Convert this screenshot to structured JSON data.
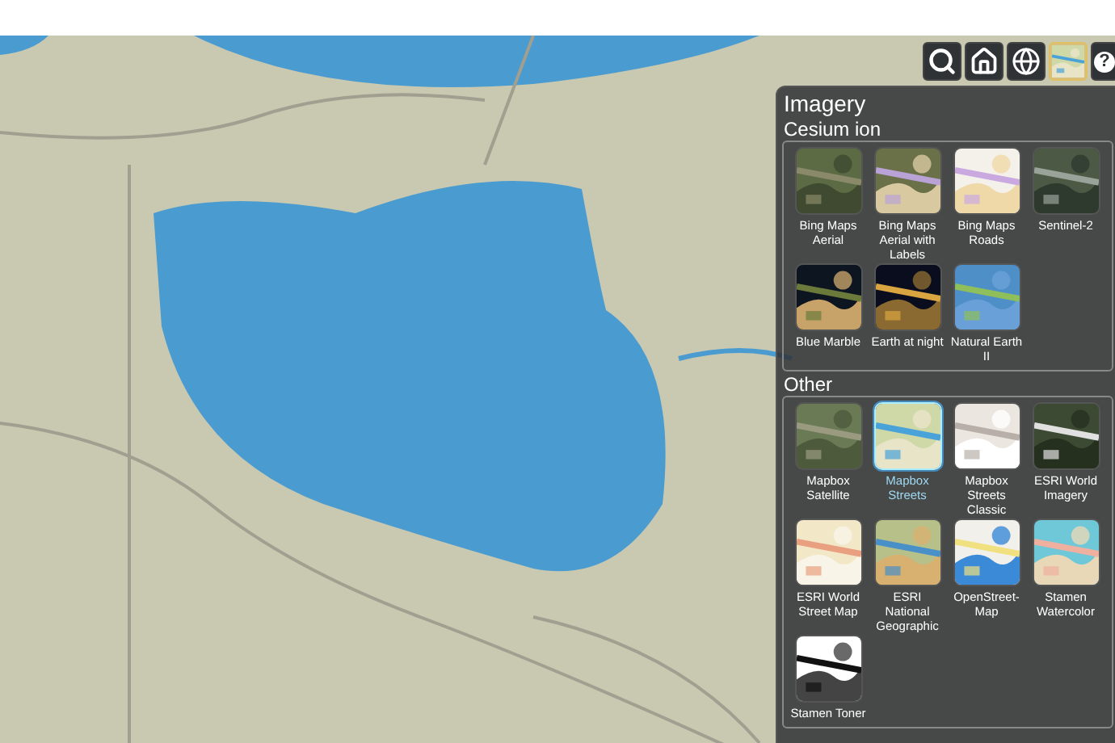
{
  "toolbar": [
    {
      "kind": "search"
    },
    {
      "kind": "home"
    },
    {
      "kind": "globe"
    },
    {
      "kind": "picker"
    },
    {
      "kind": "help",
      "label": "?"
    }
  ],
  "panel": {
    "title": "Imagery",
    "sections": [
      {
        "title": "Cesium ion",
        "items": [
          {
            "label": "Bing Maps Aerial",
            "selected": false
          },
          {
            "label": "Bing Maps Aerial with Labels",
            "selected": false
          },
          {
            "label": "Bing Maps Roads",
            "selected": false
          },
          {
            "label": "Sentinel-2",
            "selected": false
          },
          {
            "label": "Blue Marble",
            "selected": false
          },
          {
            "label": "Earth at night",
            "selected": false
          },
          {
            "label": "Natural Earth II",
            "selected": false
          }
        ]
      },
      {
        "title": "Other",
        "items": [
          {
            "label": "Mapbox Satellite",
            "selected": false
          },
          {
            "label": "Mapbox Streets",
            "selected": true
          },
          {
            "label": "Mapbox Streets Classic",
            "selected": false
          },
          {
            "label": "ESRI World Imagery",
            "selected": false
          },
          {
            "label": "ESRI World Street Map",
            "selected": false
          },
          {
            "label": "ESRI National Geographic",
            "selected": false
          },
          {
            "label": "OpenStreet-Map",
            "selected": false
          },
          {
            "label": "Stamen Watercolor",
            "selected": false
          },
          {
            "label": "Stamen Toner",
            "selected": false
          }
        ]
      }
    ]
  }
}
